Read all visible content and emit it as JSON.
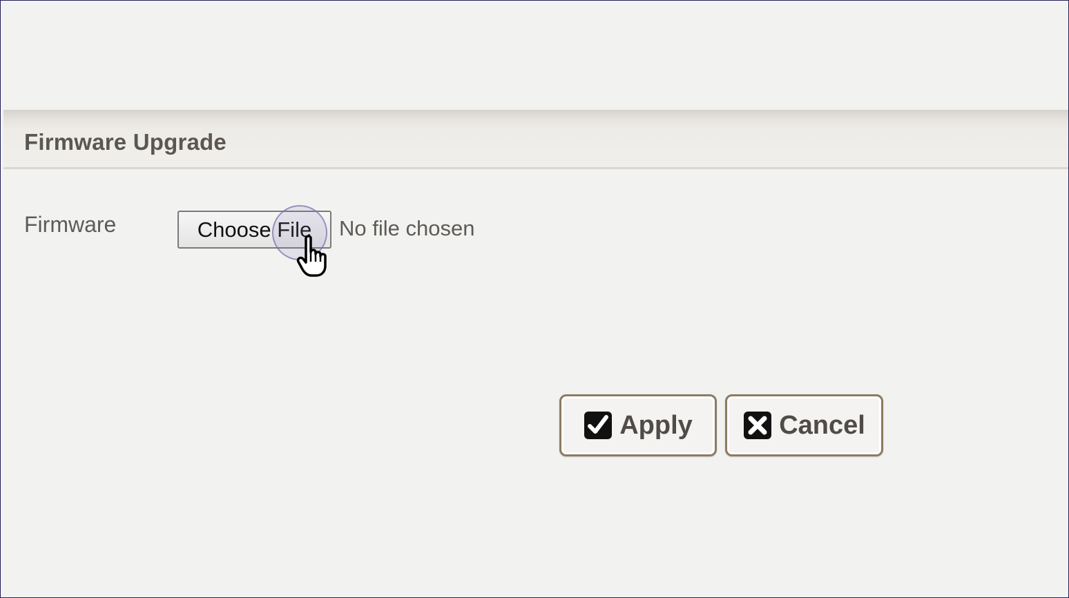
{
  "panel": {
    "title": "Firmware Upgrade"
  },
  "firmware_field": {
    "label": "Firmware",
    "choose_button": "Choose File",
    "status": "No file chosen"
  },
  "actions": {
    "apply_label": "Apply",
    "cancel_label": "Cancel"
  },
  "icons": {
    "apply": "checkbox-checked-icon",
    "cancel": "close-box-icon",
    "cursor": "hand-pointer-icon"
  },
  "colors": {
    "header_text": "#5b5650",
    "button_border": "#8c7b62",
    "frame_border": "#1f1f5a",
    "background": "#f2f2f1"
  }
}
